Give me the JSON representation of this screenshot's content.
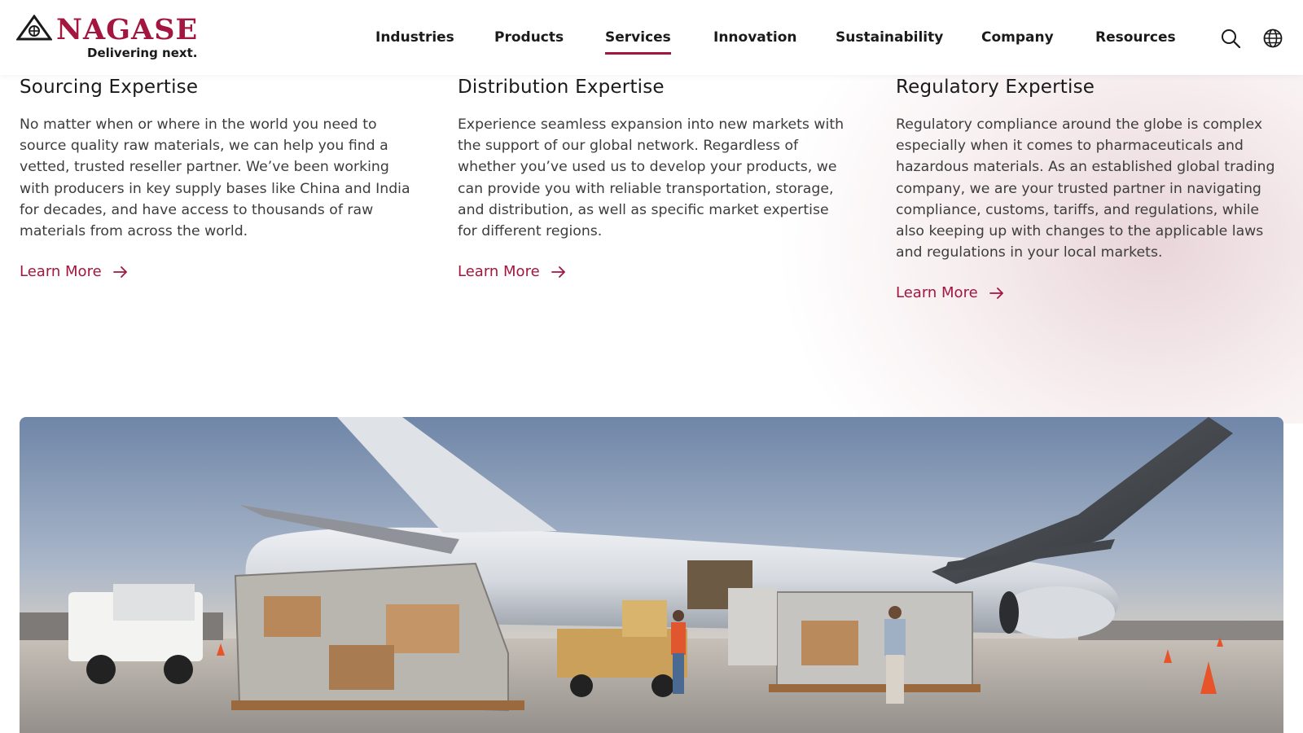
{
  "brand": {
    "name": "NAGASE",
    "tagline": "Delivering next.",
    "accent_color": "#a3163f"
  },
  "nav": {
    "items": [
      {
        "label": "Industries",
        "active": false
      },
      {
        "label": "Products",
        "active": false
      },
      {
        "label": "Services",
        "active": true
      },
      {
        "label": "Innovation",
        "active": false
      },
      {
        "label": "Sustainability",
        "active": false
      },
      {
        "label": "Company",
        "active": false
      },
      {
        "label": "Resources",
        "active": false
      }
    ],
    "icons": [
      "search-icon",
      "globe-icon"
    ]
  },
  "sections": [
    {
      "title": "Sourcing Expertise",
      "body": "No matter when or where in the world you need to source quality raw materials, we can help you find a vetted, trusted reseller partner. We’ve been working with producers in key supply bases like China and India for decades, and have access to thousands of raw materials from across the world.",
      "link": "Learn More"
    },
    {
      "title": "Distribution Expertise",
      "body": "Experience seamless expansion into new markets with the support of our global network. Regardless of whether you’ve used us to develop your products, we can provide you with reliable transportation, storage, and distribution, as well as specific market expertise for different regions.",
      "link": "Learn More"
    },
    {
      "title": "Regulatory Expertise",
      "body": "Regulatory compliance around the globe is complex especially when it comes to pharmaceuticals and hazardous materials. As an established global trading company, we are your trusted partner in navigating compliance, customs, tariffs, and regulations, while also keeping up with changes to the applicable laws and regulations in your local markets.",
      "link": "Learn More"
    }
  ],
  "hero": {
    "subject": "cargo-airplane-loading-image"
  }
}
